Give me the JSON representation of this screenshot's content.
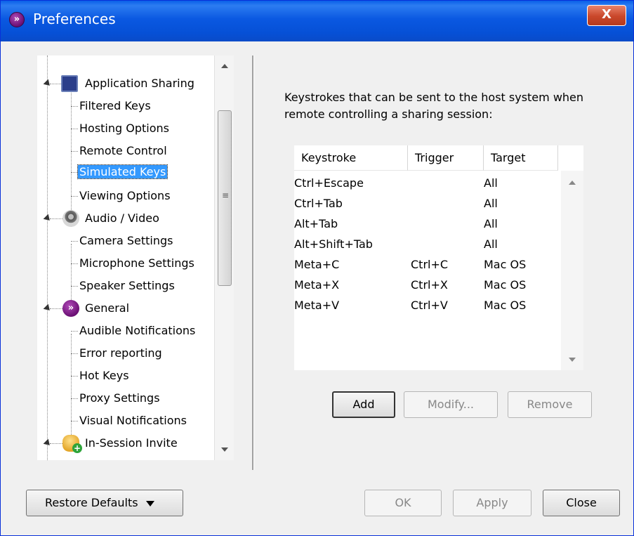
{
  "window": {
    "title": "Preferences",
    "close_label": "X"
  },
  "tree": {
    "items": [
      {
        "label": "Application Sharing",
        "level": 0,
        "icon": "monitor-icon"
      },
      {
        "label": "Filtered Keys",
        "level": 1
      },
      {
        "label": "Hosting Options",
        "level": 1
      },
      {
        "label": "Remote Control",
        "level": 1
      },
      {
        "label": "Simulated Keys",
        "level": 1,
        "selected": true
      },
      {
        "label": "Viewing Options",
        "level": 1
      },
      {
        "label": "Audio / Video",
        "level": 0,
        "icon": "webcam-icon"
      },
      {
        "label": "Camera Settings",
        "level": 1
      },
      {
        "label": "Microphone Settings",
        "level": 1
      },
      {
        "label": "Speaker Settings",
        "level": 1
      },
      {
        "label": "General",
        "level": 0,
        "icon": "general-app-icon"
      },
      {
        "label": "Audible Notifications",
        "level": 1
      },
      {
        "label": "Error reporting",
        "level": 1
      },
      {
        "label": "Hot Keys",
        "level": 1
      },
      {
        "label": "Proxy Settings",
        "level": 1
      },
      {
        "label": "Visual Notifications",
        "level": 1
      },
      {
        "label": "In-Session Invite",
        "level": 0,
        "icon": "invite-icon"
      }
    ]
  },
  "description": "Keystrokes that can be sent to the host system when remote controlling a sharing session:",
  "table": {
    "headers": [
      "Keystroke",
      "Trigger",
      "Target"
    ],
    "rows": [
      [
        "Ctrl+Escape",
        "",
        "All"
      ],
      [
        "Ctrl+Tab",
        "",
        "All"
      ],
      [
        "Alt+Tab",
        "",
        "All"
      ],
      [
        "Alt+Shift+Tab",
        "",
        "All"
      ],
      [
        "Meta+C",
        "Ctrl+C",
        "Mac OS"
      ],
      [
        "Meta+X",
        "Ctrl+X",
        "Mac OS"
      ],
      [
        "Meta+V",
        "Ctrl+V",
        "Mac OS"
      ]
    ]
  },
  "buttons": {
    "add": "Add",
    "modify": "Modify...",
    "remove": "Remove",
    "restore_defaults": "Restore Defaults",
    "ok": "OK",
    "apply": "Apply",
    "close": "Close"
  }
}
